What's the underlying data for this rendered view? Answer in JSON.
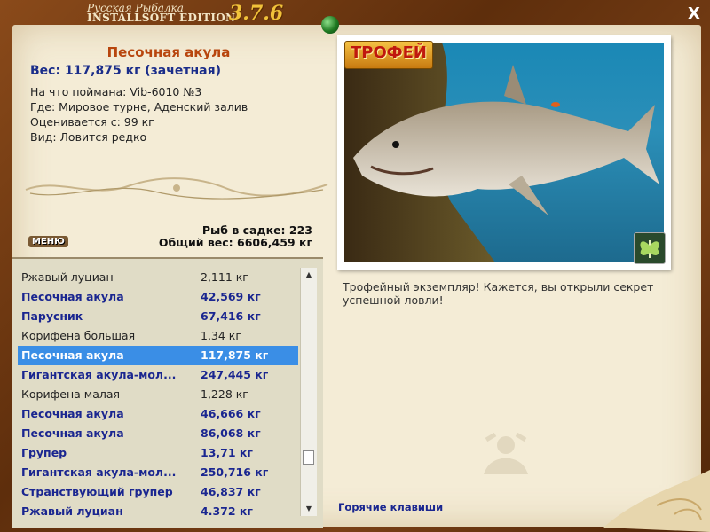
{
  "app": {
    "title_line1": "Русская Рыбалка",
    "title_line2": "INSTALLSOFT EDITION",
    "version": "3.7.6",
    "close_label": "X"
  },
  "fish": {
    "name": "Песочная акула",
    "weight_line": "Вес: 117,875 кг (зачетная)",
    "caught_on": "На что поймана: Vib-6010 №3",
    "where": "Где: Мировое турне, Аденский залив",
    "valued_from": "Оценивается с: 99 кг",
    "kind": "Вид: Ловится редко"
  },
  "menu_label": "МЕНЮ",
  "summary": {
    "count_line": "Рыб в садке: 223",
    "total_line": "Общий вес: 6606,459 кг"
  },
  "catch_list": [
    {
      "name": "Ржавый луциан",
      "weight": "2,111 кг",
      "trophy": false,
      "selected": false
    },
    {
      "name": "Песочная акула",
      "weight": "42,569 кг",
      "trophy": true,
      "selected": false
    },
    {
      "name": "Парусник",
      "weight": "67,416 кг",
      "trophy": true,
      "selected": false
    },
    {
      "name": "Корифена большая",
      "weight": "1,34 кг",
      "trophy": false,
      "selected": false
    },
    {
      "name": "Песочная акула",
      "weight": "117,875 кг",
      "trophy": true,
      "selected": true
    },
    {
      "name": "Гигантская акула-мол...",
      "weight": "247,445 кг",
      "trophy": true,
      "selected": false
    },
    {
      "name": "Корифена малая",
      "weight": "1,228 кг",
      "trophy": false,
      "selected": false
    },
    {
      "name": "Песочная акула",
      "weight": "46,666 кг",
      "trophy": true,
      "selected": false
    },
    {
      "name": "Песочная акула",
      "weight": "86,068 кг",
      "trophy": true,
      "selected": false
    },
    {
      "name": "Групер",
      "weight": "13,71 кг",
      "trophy": true,
      "selected": false
    },
    {
      "name": "Гигантская акула-мол...",
      "weight": "250,716 кг",
      "trophy": true,
      "selected": false
    },
    {
      "name": "Странствующий групер",
      "weight": "46,837 кг",
      "trophy": true,
      "selected": false
    },
    {
      "name": "Ржавый луциан",
      "weight": "4.372 кг",
      "trophy": true,
      "selected": false
    }
  ],
  "trophy_badge": "ТРОФЕЙ",
  "description": "Трофейный экземпляр! Кажется, вы открыли секрет успешной ловли!",
  "hotkeys_label": "Горячие клавиши",
  "colors": {
    "accent_title": "#b8460e",
    "trophy_text": "#1a2690",
    "selection": "#3a8ee6",
    "paper": "#f4ecd6"
  }
}
